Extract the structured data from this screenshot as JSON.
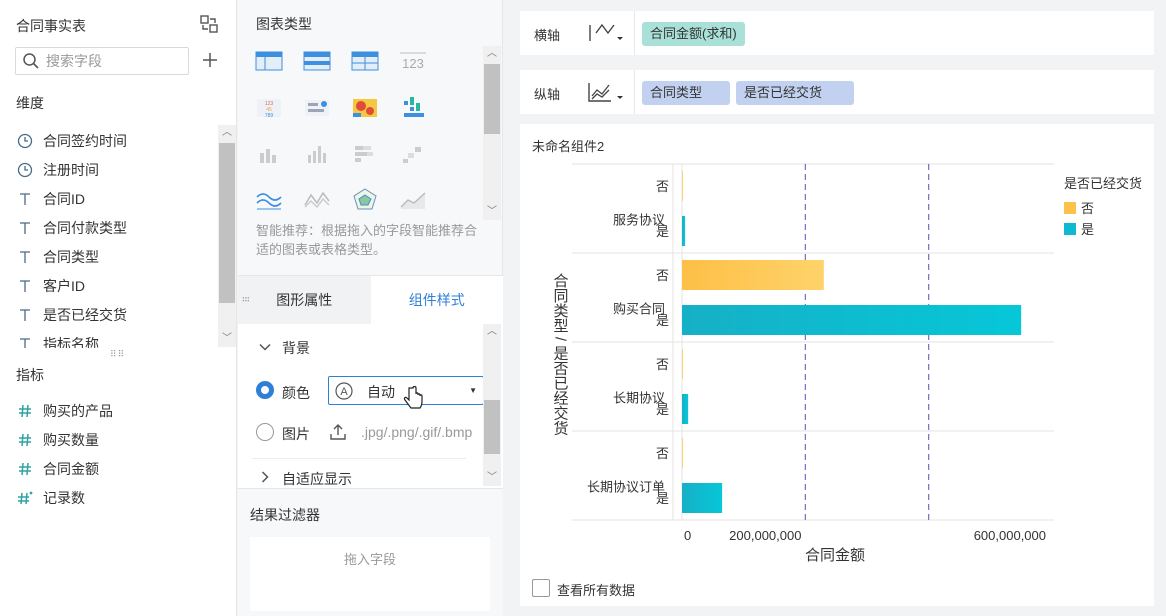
{
  "left_panel": {
    "title": "合同事实表",
    "search": {
      "placeholder": "搜索字段",
      "value": ""
    },
    "dimensions_label": "维度",
    "dimensions": [
      {
        "label": "合同签约时间",
        "icon": "clock-icon"
      },
      {
        "label": "注册时间",
        "icon": "clock-icon"
      },
      {
        "label": "合同ID",
        "icon": "text-type-icon"
      },
      {
        "label": "合同付款类型",
        "icon": "text-type-icon"
      },
      {
        "label": "合同类型",
        "icon": "text-type-icon"
      },
      {
        "label": "客户ID",
        "icon": "text-type-icon"
      },
      {
        "label": "是否已经交货",
        "icon": "text-type-icon"
      },
      {
        "label": "指标名称",
        "icon": "text-type-icon"
      }
    ],
    "measures_label": "指标",
    "measures": [
      {
        "label": "购买的产品",
        "icon": "hash-icon"
      },
      {
        "label": "购买数量",
        "icon": "hash-icon"
      },
      {
        "label": "合同金额",
        "icon": "hash-icon"
      },
      {
        "label": "记录数",
        "icon": "hash-star-icon"
      }
    ]
  },
  "middle_panel": {
    "chart_types_label": "图表类型",
    "hint": "智能推荐：根据拖入的字段智能推荐合适的图表或表格类型。",
    "tabs": [
      {
        "label": "图形属性",
        "active": false
      },
      {
        "label": "组件样式",
        "active": true
      }
    ],
    "background_section": "背景",
    "color_label": "颜色",
    "color_value": "自动",
    "image_label": "图片",
    "image_hint": ".jpg/.png/.gif/.bmp",
    "adaptive_label": "自适应显示",
    "filter_title": "结果过滤器",
    "filter_drop": "拖入字段"
  },
  "right_panel": {
    "x_axis_label": "横轴",
    "x_axis_fields": [
      "合同金额(求和)"
    ],
    "y_axis_label": "纵轴",
    "y_axis_fields": [
      "合同类型",
      "是否已经交货"
    ],
    "chart_title": "未命名组件2",
    "show_all_label": "查看所有数据"
  },
  "colors": {
    "accent": "#2f7fd8",
    "series_no": "#fdc24a",
    "series_yes": "#0fbad0",
    "ref_line": "#6f6fc0"
  },
  "chart_data": {
    "type": "bar",
    "orientation": "horizontal",
    "categories": [
      "服务协议",
      "购买合同",
      "长期协议",
      "长期协议订单"
    ],
    "sub_categories": [
      "否",
      "是"
    ],
    "series": [
      {
        "name": "否",
        "values": [
          0,
          230000000,
          0,
          0
        ]
      },
      {
        "name": "是",
        "values": [
          5000000,
          550000000,
          10000000,
          65000000
        ]
      }
    ],
    "xlabel": "合同金额",
    "ylabel": "合同类型 / 是否已经交货",
    "x_ticks": [
      {
        "value": 0,
        "label": "0"
      },
      {
        "value": 200000000,
        "label": "200,000,000"
      },
      {
        "value": 600000000,
        "label": "600,000,000"
      }
    ],
    "xlim": [
      0,
      600000000
    ],
    "reference_lines": [
      200000000,
      400000000
    ],
    "legend": {
      "title": "是否已经交货",
      "position": "right",
      "items": [
        "否",
        "是"
      ]
    }
  }
}
